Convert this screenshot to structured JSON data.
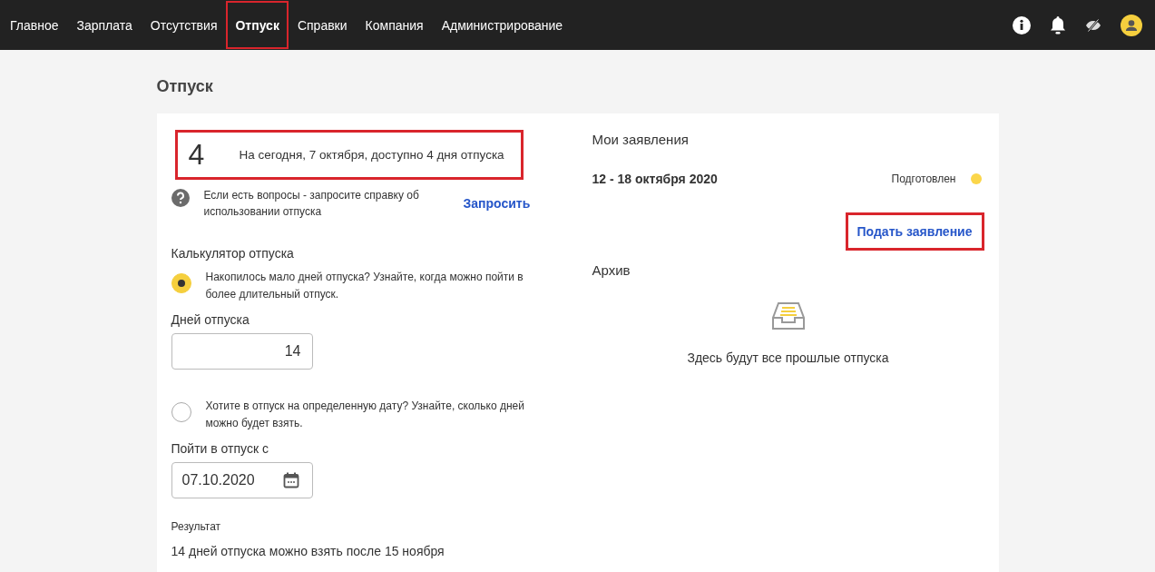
{
  "nav": [
    {
      "label": "Главное",
      "selected": false,
      "highlighted": false
    },
    {
      "label": "Зарплата",
      "selected": false,
      "highlighted": false
    },
    {
      "label": "Отсутствия",
      "selected": false,
      "highlighted": false
    },
    {
      "label": "Отпуск",
      "selected": true,
      "highlighted": true
    },
    {
      "label": "Справки",
      "selected": false,
      "highlighted": false
    },
    {
      "label": "Компания",
      "selected": false,
      "highlighted": false
    },
    {
      "label": "Администрирование",
      "selected": false,
      "highlighted": false
    }
  ],
  "page_title": "Отпуск",
  "balance": {
    "days": "4",
    "text": "На сегодня, 7 октября, доступно 4 дня отпуска",
    "highlighted": true
  },
  "help": {
    "text": "Если есть вопросы - запросите справку об использовании отпуска",
    "link": "Запросить"
  },
  "calculator": {
    "title": "Калькулятор отпуска",
    "options": [
      {
        "text": "Накопилось мало дней отпуска? Узнайте, когда можно пойти в более длительный отпуск.",
        "selected": true,
        "field_label": "Дней отпуска",
        "value": "14",
        "kind": "number"
      },
      {
        "text": "Хотите в отпуск на определенную дату? Узнайте, сколько дней можно будет взять.",
        "selected": false,
        "field_label": "Пойти в отпуск с",
        "value": "07.10.2020",
        "kind": "date"
      }
    ],
    "result_label": "Результат",
    "result": "14 дней отпуска можно взять после 15 ноября"
  },
  "requests": {
    "title": "Мои заявления",
    "items": [
      {
        "dates": "12 - 18 октября 2020",
        "status": "Подготовлен",
        "color": "#fbd64a"
      }
    ],
    "submit": {
      "label": "Подать заявление",
      "highlighted": true
    }
  },
  "archive": {
    "title": "Архив",
    "empty_text": "Здесь будут все прошлые отпуска"
  }
}
